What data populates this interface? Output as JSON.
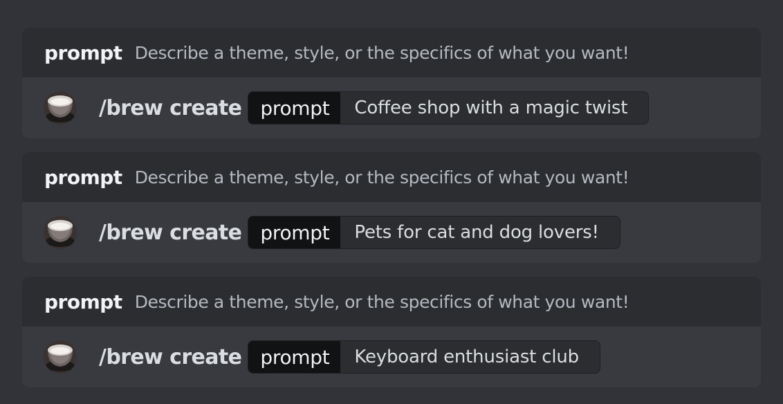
{
  "commands": [
    {
      "option_name": "prompt",
      "option_description": "Describe a theme, style, or the specifics of what you want!",
      "avatar": "coffee-cup-avatar",
      "command": "/brew create",
      "param_name": "prompt",
      "param_value": "Coffee shop with a magic twist"
    },
    {
      "option_name": "prompt",
      "option_description": "Describe a theme, style, or the specifics of what you want!",
      "avatar": "coffee-cup-avatar",
      "command": "/brew create",
      "param_name": "prompt",
      "param_value": "Pets for cat and dog lovers!"
    },
    {
      "option_name": "prompt",
      "option_description": "Describe a theme, style, or the specifics of what you want!",
      "avatar": "coffee-cup-avatar",
      "command": "/brew create",
      "param_name": "prompt",
      "param_value": "Keyboard enthusiast club"
    }
  ],
  "colors": {
    "background": "#313338",
    "header_bg": "#2b2d31",
    "body_bg": "#383a40",
    "param_name_bg": "#111214"
  }
}
